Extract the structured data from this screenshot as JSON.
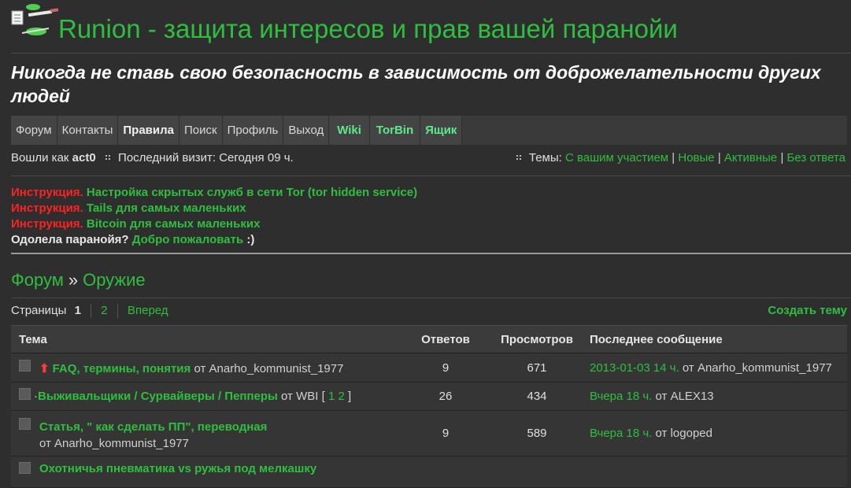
{
  "header": {
    "title": "Runion - защита интересов и прав вашей паранойи",
    "tagline": "Никогда не ставь свою безопасность в зависимость от доброжелательности других людей"
  },
  "nav": [
    {
      "label": "Форум"
    },
    {
      "label": "Контакты"
    },
    {
      "label": "Правила"
    },
    {
      "label": "Поиск"
    },
    {
      "label": "Профиль"
    },
    {
      "label": "Выход"
    },
    {
      "label": "Wiki"
    },
    {
      "label": "TorBin"
    },
    {
      "label": "Ящик"
    }
  ],
  "userbar": {
    "logged_prefix": "Вошли как",
    "username": "act0",
    "last_visit": "Последний визит: Сегодня 09 ч.",
    "topics_label": "Темы:",
    "topics_links": [
      "С вашим участием",
      "Новые",
      "Активные",
      "Без ответа"
    ],
    "sep": "|"
  },
  "notices": [
    {
      "prefix": "Инструкция.",
      "link": "Настройка скрытых служб в сети Tor (tor hidden service)"
    },
    {
      "prefix": "Инструкция.",
      "link": "Tails для самых маленьких"
    },
    {
      "prefix": "Инструкция.",
      "link": "Bitcoin для самых маленьких"
    }
  ],
  "welcome": {
    "text": "Одолела паранойя?",
    "link": "Добро пожаловать",
    "smile": ":)"
  },
  "breadcrumb": {
    "root": "Форум",
    "sep": "»",
    "current": "Оружие"
  },
  "pagination": {
    "label": "Страницы",
    "current": "1",
    "next_page": "2",
    "next": "Вперед",
    "create": "Создать тему"
  },
  "table": {
    "headers": {
      "topic": "Тема",
      "replies": "Ответов",
      "views": "Просмотров",
      "last": "Последнее сообщение"
    },
    "rows": [
      {
        "title": "FAQ, термины, понятия",
        "by": "от Anarho_kommunist_1977",
        "replies": "9",
        "views": "671",
        "last_date": "2013-01-03 14 ч.",
        "last_by": "от Anarho_kommunist_1977",
        "sticky": true
      },
      {
        "title": "Выживальщики / Сурвайверы / Пепперы",
        "by": "от WBI",
        "pages": [
          "1",
          "2"
        ],
        "replies": "26",
        "views": "434",
        "last_date": "Вчера 18 ч.",
        "last_by": "от ALEX13"
      },
      {
        "title": "Статья, \" как сделать ПП\", переводная",
        "by": "от Anarho_kommunist_1977",
        "replies": "9",
        "views": "589",
        "last_date": "Вчера 18 ч.",
        "last_by": "от logoped"
      },
      {
        "title": "Охотничья пневматика vs ружья под мелкашку",
        "by": "",
        "replies": "",
        "views": "",
        "last_date": "",
        "last_by": ""
      }
    ]
  },
  "icons": {
    "logo": "pens-notebook-logo-icon",
    "grip": "grip-dots-icon",
    "sticky": "up-arrow-icon"
  }
}
